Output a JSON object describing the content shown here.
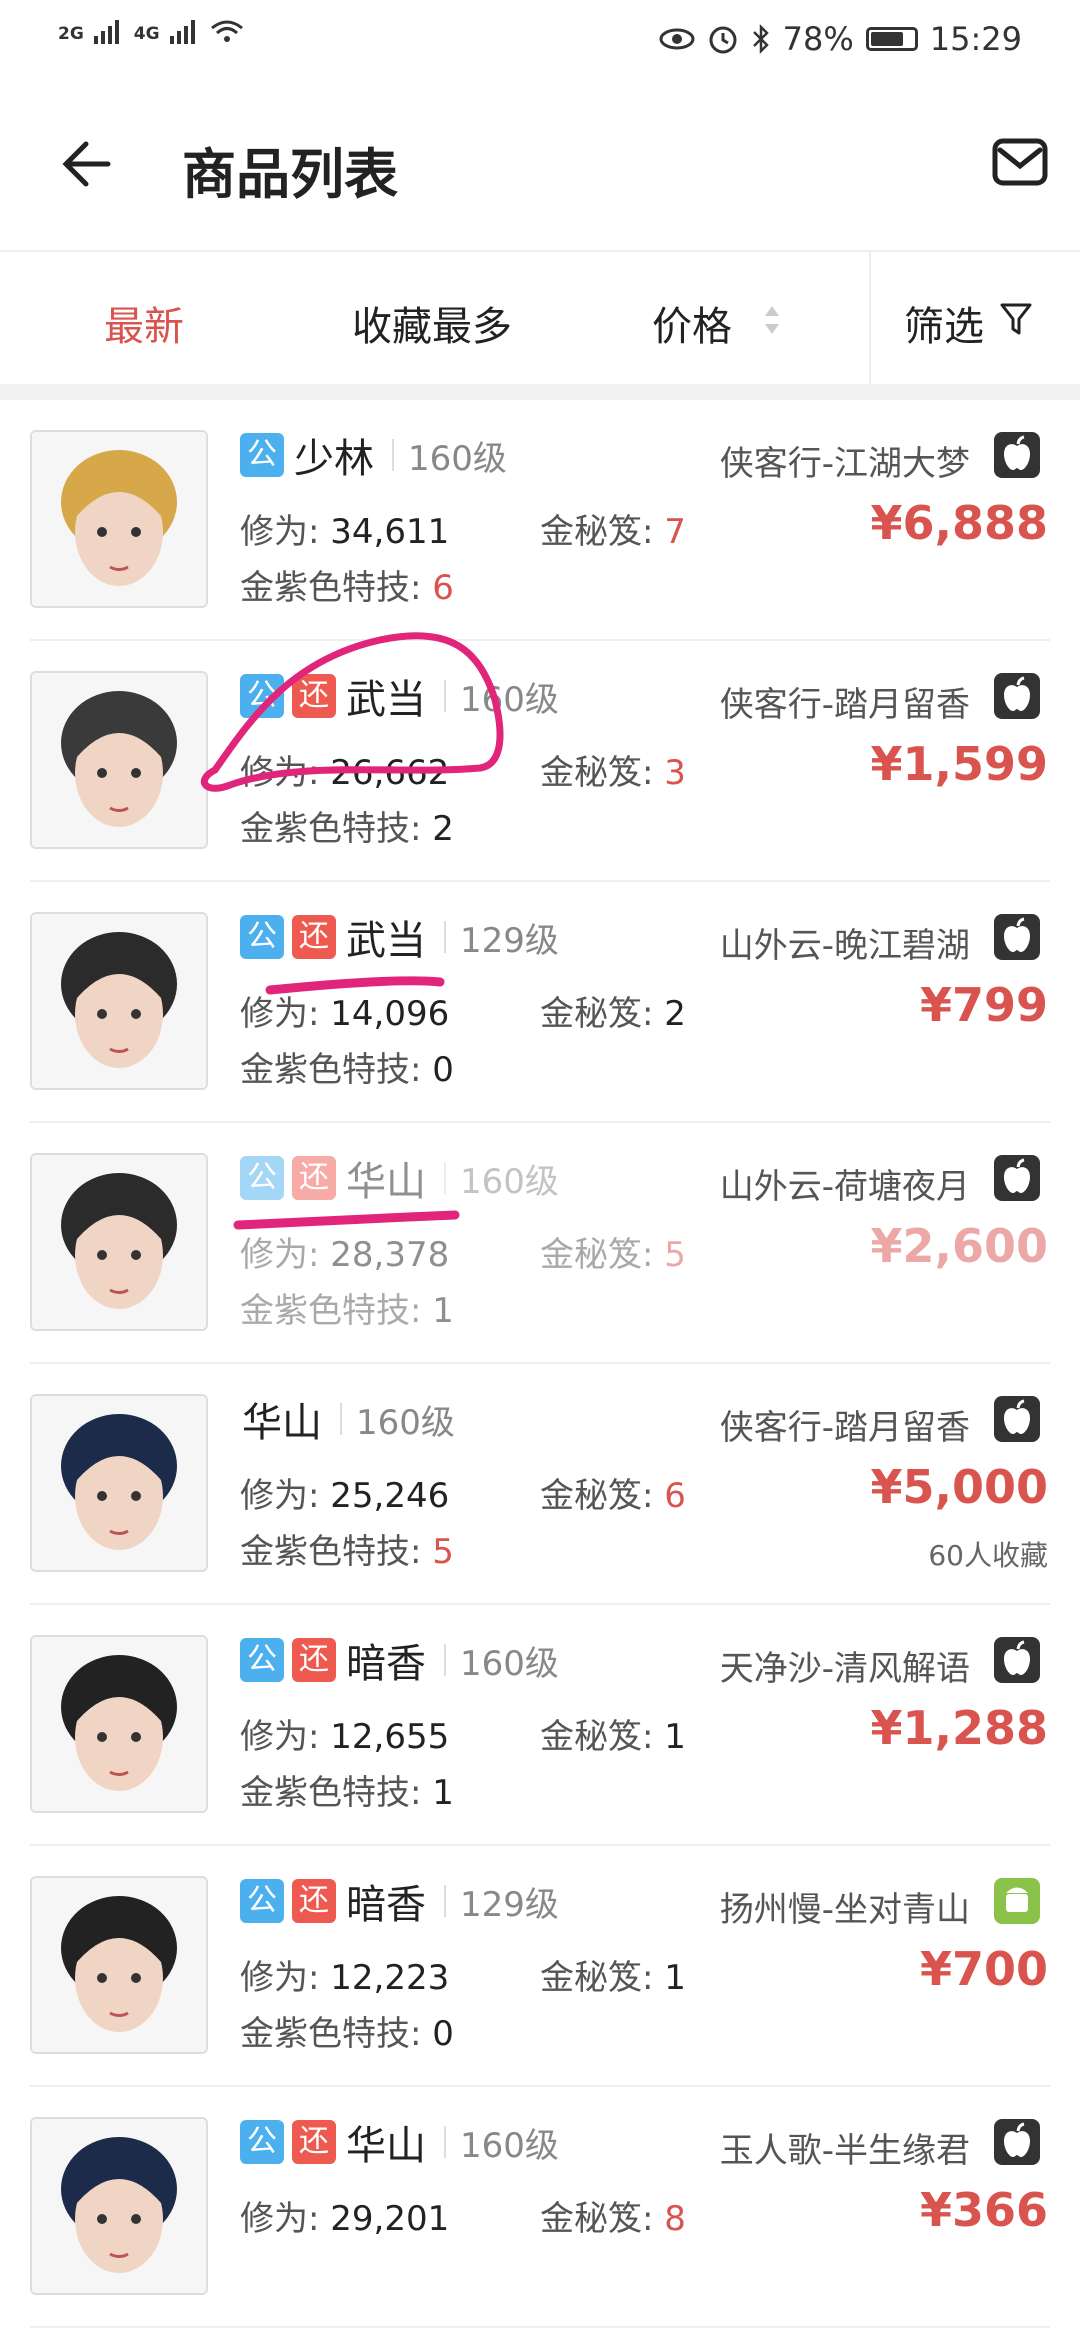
{
  "status_bar": {
    "net1": "2G",
    "net2": "4G",
    "battery": "78%",
    "time": "15:29"
  },
  "header": {
    "title": "商品列表"
  },
  "tabs": [
    {
      "label": "最新",
      "active": true
    },
    {
      "label": "收藏最多",
      "active": false
    },
    {
      "label": "价格",
      "active": false
    },
    {
      "label": "筛选",
      "active": false
    }
  ],
  "labels": {
    "xiuwei": "修为: ",
    "mijian": "金秘笈: ",
    "tech": "金紫色特技: ",
    "gong": "公",
    "huan": "还"
  },
  "items": [
    {
      "sect": "少林",
      "level": "160级",
      "server": "侠客行-江湖大梦",
      "os": "apple-icon",
      "xiuwei": "34,611",
      "mijian": "7",
      "tech": "6",
      "price": "¥6,888",
      "badges": [
        "公"
      ],
      "fav": ""
    },
    {
      "sect": "武当",
      "level": "160级",
      "server": "侠客行-踏月留香",
      "os": "apple-icon",
      "xiuwei": "26,662",
      "mijian": "3",
      "tech": "2",
      "price": "¥1,599",
      "badges": [
        "公",
        "还"
      ],
      "fav": ""
    },
    {
      "sect": "武当",
      "level": "129级",
      "server": "山外云-晚江碧湖",
      "os": "apple-icon",
      "xiuwei": "14,096",
      "mijian": "2",
      "tech": "0",
      "price": "¥799",
      "badges": [
        "公",
        "还"
      ],
      "fav": ""
    },
    {
      "sect": "华山",
      "level": "160级",
      "server": "山外云-荷塘夜月",
      "os": "apple-icon",
      "xiuwei": "28,378",
      "mijian": "5",
      "tech": "1",
      "price": "¥2,600",
      "badges": [
        "公",
        "还"
      ],
      "fav": ""
    },
    {
      "sect": "华山",
      "level": "160级",
      "server": "侠客行-踏月留香",
      "os": "apple-icon",
      "xiuwei": "25,246",
      "mijian": "6",
      "tech": "5",
      "price": "¥5,000",
      "badges": [],
      "fav": "60人收藏"
    },
    {
      "sect": "暗香",
      "level": "160级",
      "server": "天净沙-清风解语",
      "os": "apple-icon",
      "xiuwei": "12,655",
      "mijian": "1",
      "tech": "1",
      "price": "¥1,288",
      "badges": [
        "公",
        "还"
      ],
      "fav": ""
    },
    {
      "sect": "暗香",
      "level": "129级",
      "server": "扬州慢-坐对青山",
      "os": "android-icon",
      "xiuwei": "12,223",
      "mijian": "1",
      "tech": "0",
      "price": "¥700",
      "badges": [
        "公",
        "还"
      ],
      "fav": ""
    },
    {
      "sect": "华山",
      "level": "160级",
      "server": "玉人歌-半生缘君",
      "os": "apple-icon",
      "xiuwei": "29,201",
      "mijian": "8",
      "tech": "",
      "price": "¥366",
      "badges": [
        "公",
        "还"
      ],
      "fav": ""
    }
  ],
  "colors": {
    "accent": "#d9534f",
    "badge_gong": "#4cb0ee",
    "badge_huan": "#ee5a4f",
    "annotation": "#e0257a"
  }
}
